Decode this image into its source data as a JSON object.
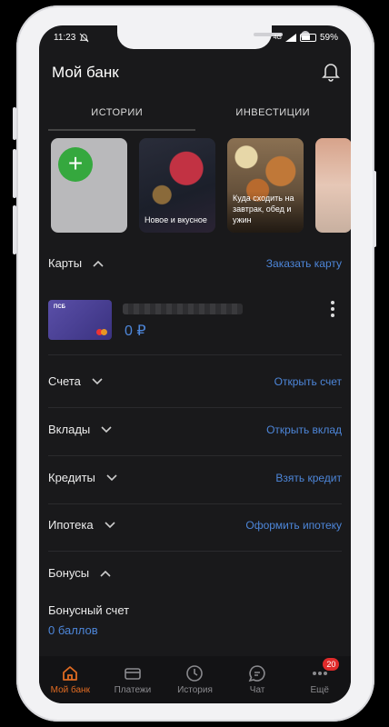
{
  "status": {
    "time": "11:23",
    "battery": "59%",
    "network": "4G"
  },
  "header": {
    "title": "Мой банк"
  },
  "tabs": [
    {
      "label": "ИСТОРИИ"
    },
    {
      "label": "ИНВЕСТИЦИИ"
    }
  ],
  "stories": [
    {
      "caption": ""
    },
    {
      "caption": "Новое и вкусное"
    },
    {
      "caption": "Куда сходить на завтрак, обед и ужин"
    },
    {
      "caption": ""
    }
  ],
  "cards": {
    "title": "Карты",
    "action": "Заказать карту",
    "card": {
      "logo": "ПСБ",
      "balance": "0 ₽"
    }
  },
  "accounts": {
    "title": "Счета",
    "action": "Открыть счет"
  },
  "deposits": {
    "title": "Вклады",
    "action": "Открыть вклад"
  },
  "credits": {
    "title": "Кредиты",
    "action": "Взять кредит"
  },
  "mortgage": {
    "title": "Ипотека",
    "action": "Оформить ипотеку"
  },
  "bonuses": {
    "title": "Бонусы",
    "account_label": "Бонусный счет",
    "points": "0 баллов"
  },
  "nav": [
    {
      "label": "Мой банк",
      "icon": "home-icon",
      "active": true
    },
    {
      "label": "Платежи",
      "icon": "card-icon"
    },
    {
      "label": "История",
      "icon": "clock-icon"
    },
    {
      "label": "Чат",
      "icon": "chat-icon"
    },
    {
      "label": "Ещё",
      "icon": "more-icon",
      "badge": "20"
    }
  ],
  "colors": {
    "accent": "#4d86d9",
    "active_nav": "#e06b22",
    "background": "#19191b",
    "badge": "#e02b2b"
  }
}
